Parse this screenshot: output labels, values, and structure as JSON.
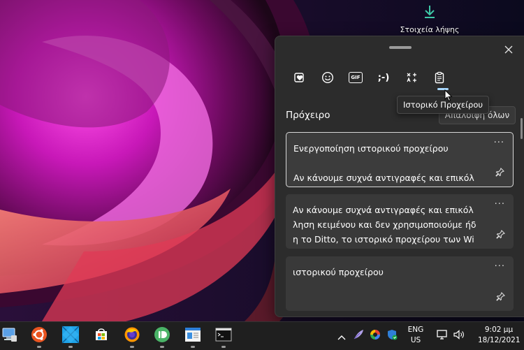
{
  "desktop": {
    "download_icon": "download-arrow-icon",
    "download_label": "Στοιχεία λήψης"
  },
  "panel": {
    "tabs": [
      {
        "icon": "favorites-heart-icon"
      },
      {
        "icon": "emoji-smiley-icon"
      },
      {
        "icon": "gif-icon",
        "text": "GIF"
      },
      {
        "icon": "kaomoji-icon",
        "text": ";-)"
      },
      {
        "icon": "symbols-icon"
      },
      {
        "icon": "clipboard-icon"
      }
    ],
    "tooltip": "Ιστορικό Προχείρου",
    "section_title": "Πρόχειρο",
    "clear_all": "Απαλοιφή όλων",
    "items": [
      {
        "text": "Ενεργοποίηση ιστορικού προχείρου\n\nΑν κάνουμε συχνά αντιγραφές και επικόλ",
        "more": "···"
      },
      {
        "text": "Αν κάνουμε συχνά αντιγραφές και επικόλ\nληση κειμένου και δεν χρησιμοποιούμε ήδ\nη το Ditto, το ιστορικό προχείρου των Wi",
        "more": "···"
      },
      {
        "text": "ιστορικού προχείρου",
        "more": "···"
      }
    ]
  },
  "taskbar": {
    "language_line1": "ENG",
    "language_line2": "US",
    "time": "9:02 μμ",
    "date": "18/12/2021",
    "apps": [
      "this-pc-icon",
      "ubuntu-icon",
      "windows-store-alt-icon",
      "microsoft-store-icon",
      "firefox-icon",
      "pushbullet-icon",
      "notepad-icon",
      "terminal-icon"
    ],
    "tray": [
      "chevron-up-icon",
      "feather-icon",
      "photos-icon",
      "security-shield-icon",
      "network-icon",
      "volume-icon"
    ]
  },
  "colors": {
    "panel_bg": "#2c2c2c",
    "card_bg": "#393939",
    "accent": "#a8d8ff",
    "taskbar_bg": "#1f1f1f"
  }
}
